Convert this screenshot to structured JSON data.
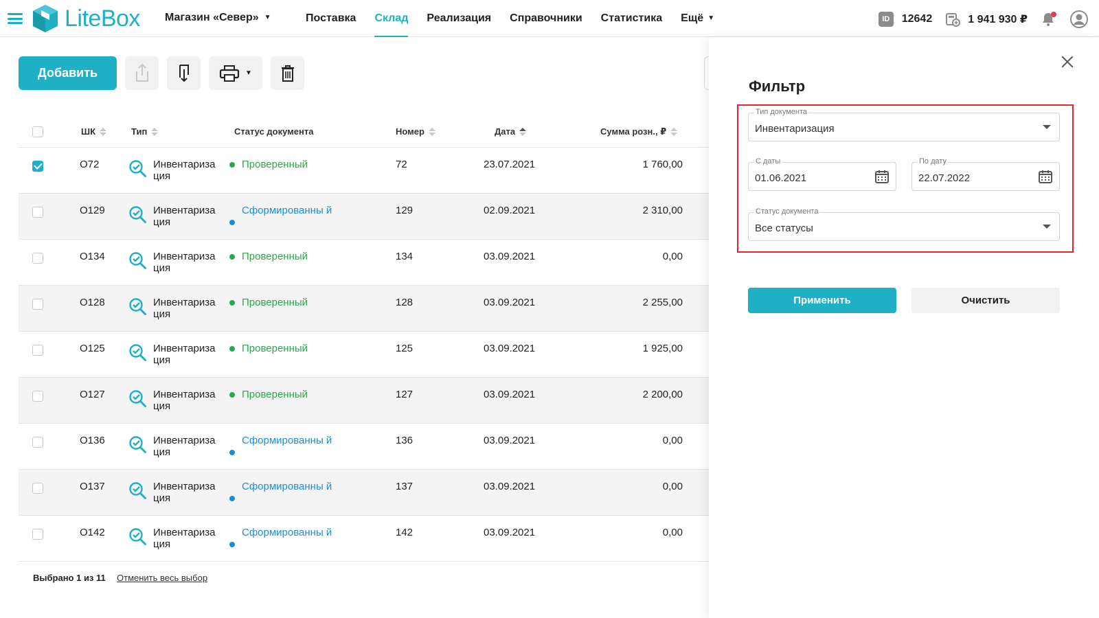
{
  "header": {
    "logo_text": "LiteBox",
    "store_name": "Магазин «Север»",
    "nav": [
      {
        "label": "Поставка"
      },
      {
        "label": "Склад"
      },
      {
        "label": "Реализация"
      },
      {
        "label": "Справочники"
      },
      {
        "label": "Статистика"
      },
      {
        "label": "Ещё"
      }
    ],
    "id_badge": "ID",
    "account_id": "12642",
    "balance": "1 941 930 ₽"
  },
  "toolbar": {
    "add_label": "Добавить"
  },
  "table": {
    "columns": {
      "barcode": "ШК",
      "type": "Тип",
      "status": "Статус документа",
      "number": "Номер",
      "date": "Дата",
      "sum": "Сумма розн., ₽"
    },
    "rows": [
      {
        "barcode": "О72",
        "type": "Инвентариза ция",
        "status": "Проверенный",
        "status_kind": "checked",
        "number": "72",
        "date": "23.07.2021",
        "sum": "1 760,00",
        "selected": true
      },
      {
        "barcode": "О129",
        "type": "Инвентариза ция",
        "status": "Сформированны й",
        "status_kind": "formed",
        "number": "129",
        "date": "02.09.2021",
        "sum": "2 310,00",
        "selected": false
      },
      {
        "barcode": "О134",
        "type": "Инвентариза ция",
        "status": "Проверенный",
        "status_kind": "checked",
        "number": "134",
        "date": "03.09.2021",
        "sum": "0,00",
        "selected": false
      },
      {
        "barcode": "О128",
        "type": "Инвентариза ция",
        "status": "Проверенный",
        "status_kind": "checked",
        "number": "128",
        "date": "03.09.2021",
        "sum": "2 255,00",
        "selected": false
      },
      {
        "barcode": "О125",
        "type": "Инвентариза ция",
        "status": "Проверенный",
        "status_kind": "checked",
        "number": "125",
        "date": "03.09.2021",
        "sum": "1 925,00",
        "selected": false
      },
      {
        "barcode": "О127",
        "type": "Инвентариза ция",
        "status": "Проверенный",
        "status_kind": "checked",
        "number": "127",
        "date": "03.09.2021",
        "sum": "2 200,00",
        "selected": false
      },
      {
        "barcode": "О136",
        "type": "Инвентариза ция",
        "status": "Сформированны й",
        "status_kind": "formed",
        "number": "136",
        "date": "03.09.2021",
        "sum": "0,00",
        "selected": false
      },
      {
        "barcode": "О137",
        "type": "Инвентариза ция",
        "status": "Сформированны й",
        "status_kind": "formed",
        "number": "137",
        "date": "03.09.2021",
        "sum": "0,00",
        "selected": false
      },
      {
        "barcode": "О142",
        "type": "Инвентариза ция",
        "status": "Сформированны й",
        "status_kind": "formed",
        "number": "142",
        "date": "03.09.2021",
        "sum": "0,00",
        "selected": false
      }
    ]
  },
  "footer": {
    "selected_text": "Выбрано 1 из 11",
    "clear_link": "Отменить весь выбор"
  },
  "filter": {
    "title": "Фильтр",
    "doc_type": {
      "label": "Тип документа",
      "value": "Инвентаризация"
    },
    "date_from": {
      "label": "С даты",
      "value": "01.06.2021"
    },
    "date_to": {
      "label": "По дату",
      "value": "22.07.2022"
    },
    "doc_status": {
      "label": "Статус документа",
      "value": "Все статусы"
    },
    "apply_label": "Применить",
    "clear_label": "Очистить"
  },
  "colors": {
    "accent": "#1fb0c5",
    "status_checked": "#2ba84a",
    "status_formed": "#1a8fd6",
    "highlight": "#e3262a"
  }
}
